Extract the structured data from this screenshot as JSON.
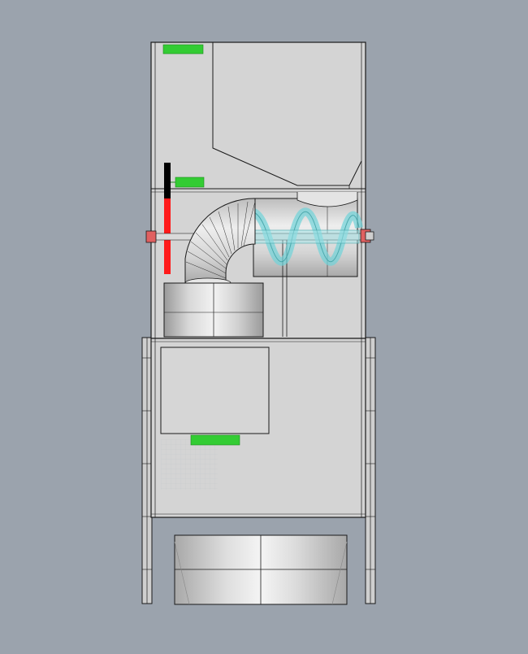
{
  "colors": {
    "background": "#9ba3ad",
    "panel_fill": "#d2d2d2",
    "outline": "#1a1a1a",
    "marker_green": "#33cc33",
    "indicator_red": "#ff1a1a",
    "indicator_black": "#000000",
    "auger_cyan": "#6fd3d8",
    "bolt_red": "#e06060"
  },
  "components": [
    "upper-hopper-housing",
    "feed-hopper-chute",
    "elbow-duct",
    "auger-conveyor",
    "collection-drum",
    "access-panel",
    "lower-cabinet",
    "bottom-tray",
    "side-rail-left",
    "side-rail-right",
    "level-indicator",
    "marker-top",
    "marker-middle",
    "marker-panel"
  ]
}
